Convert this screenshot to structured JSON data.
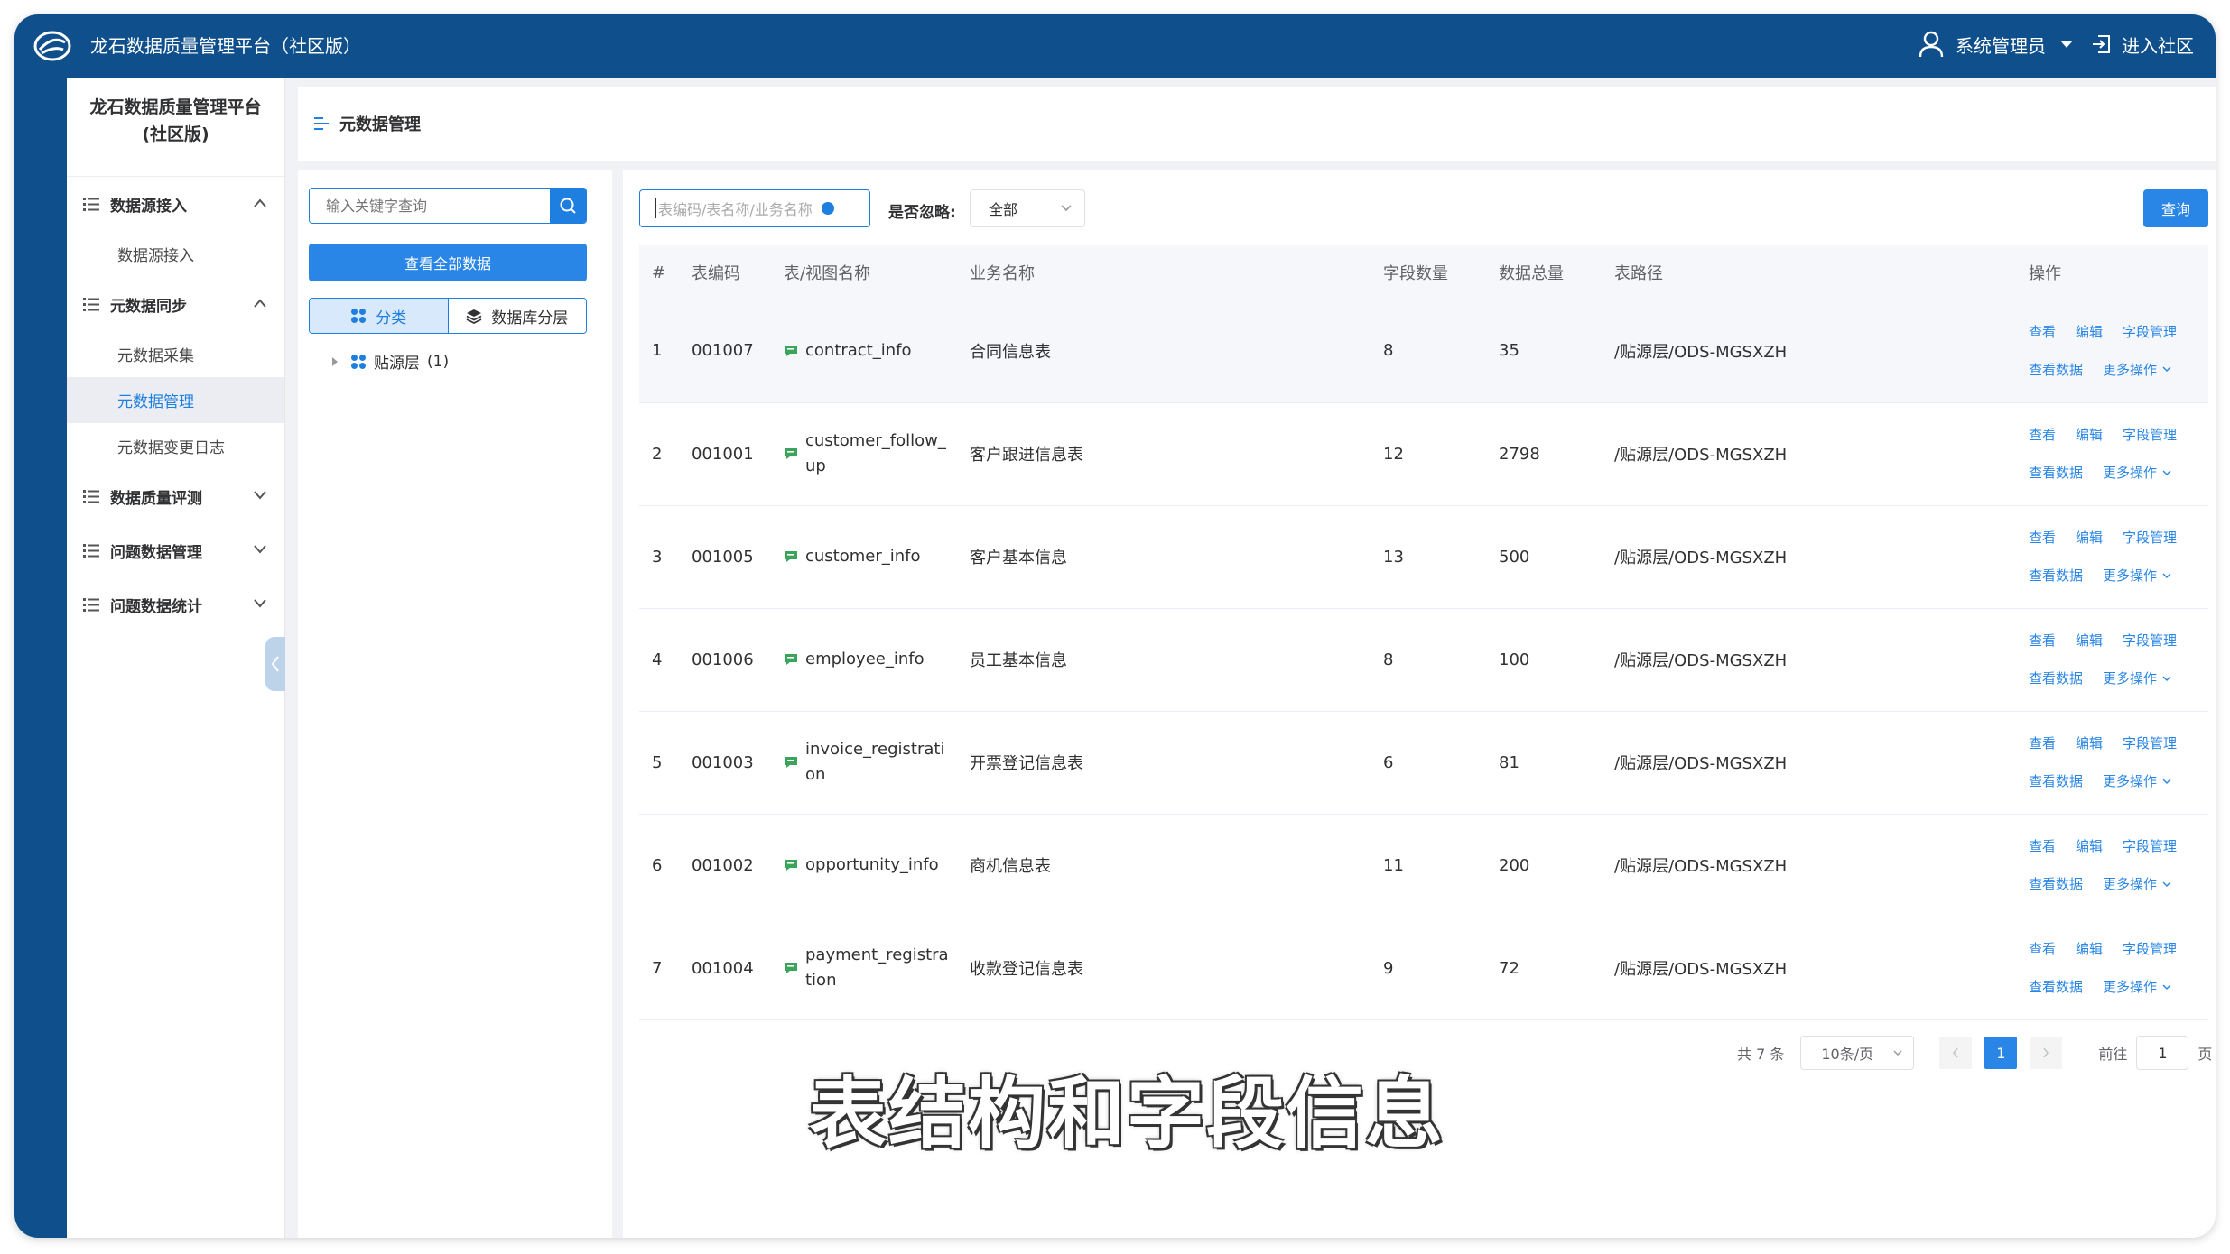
{
  "topbar": {
    "title": "龙石数据质量管理平台（社区版）",
    "user": "系统管理员",
    "enter_community": "进入社区"
  },
  "sidebar": {
    "title_line1": "龙石数据质量管理平台",
    "title_line2": "(社区版)",
    "groups": [
      {
        "label": "数据源接入",
        "expanded": true,
        "items": [
          "数据源接入"
        ]
      },
      {
        "label": "元数据同步",
        "expanded": true,
        "items": [
          "元数据采集",
          "元数据管理",
          "元数据变更日志"
        ]
      },
      {
        "label": "数据质量评测",
        "expanded": false
      },
      {
        "label": "问题数据管理",
        "expanded": false
      },
      {
        "label": "问题数据统计",
        "expanded": false
      }
    ],
    "active_item": "元数据管理"
  },
  "breadcrumb": {
    "title": "元数据管理"
  },
  "tree": {
    "search_placeholder": "输入关键字查询",
    "view_all": "查看全部数据",
    "tab_category": "分类",
    "tab_layer": "数据库分层",
    "node_label": "贴源层",
    "node_count": "(1)"
  },
  "filters": {
    "code_placeholder": "表编码/表名称/业务名称",
    "ignore_label": "是否忽略:",
    "ignore_value": "全部",
    "query": "查询"
  },
  "table": {
    "headers": [
      "#",
      "表编码",
      "表/视图名称",
      "业务名称",
      "字段数量",
      "数据总量",
      "表路径",
      "操作"
    ],
    "rows": [
      {
        "idx": "1",
        "code": "001007",
        "name": "contract_info",
        "biz": "合同信息表",
        "fields": "8",
        "total": "35",
        "path": "/贴源层/ODS-MGSXZH"
      },
      {
        "idx": "2",
        "code": "001001",
        "name": "customer_follow_up",
        "biz": "客户跟进信息表",
        "fields": "12",
        "total": "2798",
        "path": "/贴源层/ODS-MGSXZH"
      },
      {
        "idx": "3",
        "code": "001005",
        "name": "customer_info",
        "biz": "客户基本信息",
        "fields": "13",
        "total": "500",
        "path": "/贴源层/ODS-MGSXZH"
      },
      {
        "idx": "4",
        "code": "001006",
        "name": "employee_info",
        "biz": "员工基本信息",
        "fields": "8",
        "total": "100",
        "path": "/贴源层/ODS-MGSXZH"
      },
      {
        "idx": "5",
        "code": "001003",
        "name": "invoice_registration",
        "biz": "开票登记信息表",
        "fields": "6",
        "total": "81",
        "path": "/贴源层/ODS-MGSXZH"
      },
      {
        "idx": "6",
        "code": "001002",
        "name": "opportunity_info",
        "biz": "商机信息表",
        "fields": "11",
        "total": "200",
        "path": "/贴源层/ODS-MGSXZH"
      },
      {
        "idx": "7",
        "code": "001004",
        "name": "payment_registration",
        "biz": "收款登记信息表",
        "fields": "9",
        "total": "72",
        "path": "/贴源层/ODS-MGSXZH"
      }
    ],
    "ops": {
      "view": "查看",
      "edit": "编辑",
      "fields": "字段管理",
      "view_data": "查看数据",
      "more": "更多操作"
    }
  },
  "pagination": {
    "total": "共 7 条",
    "page_size": "10条/页",
    "current": "1",
    "goto_prefix": "前往",
    "goto_value": "1",
    "goto_suffix": "页"
  },
  "caption": "表结构和字段信息",
  "colors": {
    "primary": "#2a86e6",
    "topbar": "#0f4f8c",
    "table_icon": "#3aa55a"
  }
}
